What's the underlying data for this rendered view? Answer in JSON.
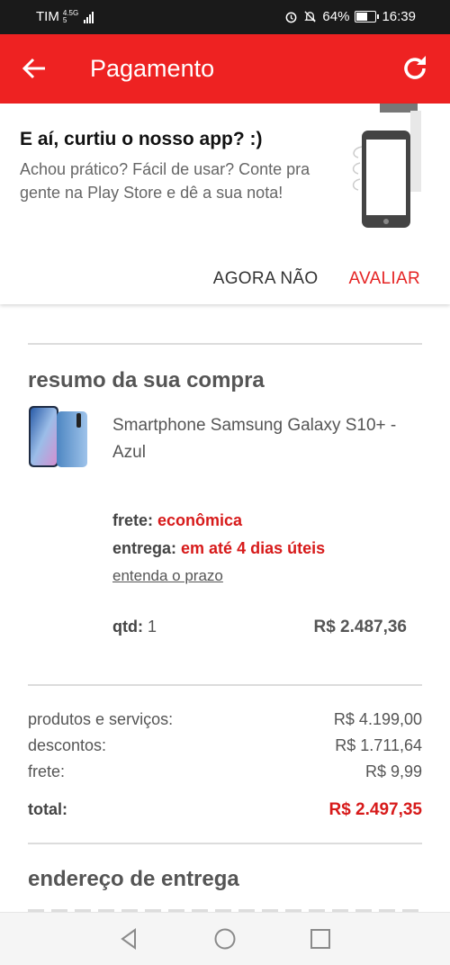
{
  "status": {
    "carrier": "TIM",
    "net_up": "4.5G",
    "net_down": "5",
    "battery": "64%",
    "time": "16:39",
    "battery_level": 0.64
  },
  "appbar": {
    "title": "Pagamento"
  },
  "rating": {
    "heading": "E aí, curtiu o nosso app? :)",
    "body": "Achou prático? Fácil de usar? Conte pra gente na Play Store e dê a sua nota!",
    "later": "AGORA NÃO",
    "rate": "AVALIAR"
  },
  "summary": {
    "title": "resumo da sua compra",
    "product": "Smartphone Samsung Galaxy S10+ - Azul",
    "frete_label": "frete:",
    "frete_value": "econômica",
    "entrega_label": "entrega:",
    "entrega_value": "em até 4 dias úteis",
    "prazo_link": "entenda o prazo",
    "qtd_label": "qtd:",
    "qtd_value": "1",
    "price": "R$ 2.487,36"
  },
  "totals": {
    "rows": [
      {
        "label": "produtos e serviços:",
        "value": "R$ 4.199,00"
      },
      {
        "label": "descontos:",
        "value": "R$ 1.711,64"
      },
      {
        "label": "frete:",
        "value": "R$ 9,99"
      }
    ],
    "total_label": "total:",
    "total_value": "R$ 2.497,35"
  },
  "address": {
    "title": "endereço de entrega"
  },
  "colors": {
    "brand": "#ee2222",
    "accent_red": "#d71a1a"
  }
}
